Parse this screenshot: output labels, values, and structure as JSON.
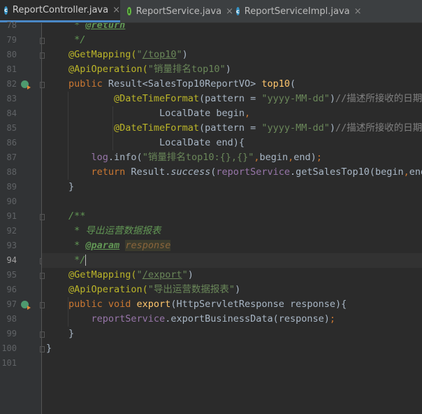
{
  "tabs": [
    {
      "label": "ReportController.java",
      "icon": "class-icon",
      "active": true
    },
    {
      "label": "ReportService.java",
      "icon": "interface-icon",
      "active": false
    },
    {
      "label": "ReportServiceImpl.java",
      "icon": "class-icon",
      "active": false
    }
  ],
  "tab_close_glyph": "×",
  "line_numbers": [
    "78",
    "79",
    "80",
    "81",
    "82",
    "83",
    "84",
    "85",
    "86",
    "87",
    "88",
    "89",
    "90",
    "91",
    "92",
    "93",
    "94",
    "95",
    "96",
    "97",
    "98",
    "99",
    "100",
    "101"
  ],
  "current_line": "94",
  "code_lines": [
    [
      {
        "t": " * ",
        "c": "dc"
      },
      {
        "t": "@return",
        "c": "dt"
      }
    ],
    [
      {
        "t": " */",
        "c": "dc"
      }
    ],
    [
      {
        "t": "@GetMapping(",
        "c": "an"
      },
      {
        "t": "\"",
        "c": "st"
      },
      {
        "t": "/top10",
        "c": "st ul"
      },
      {
        "t": "\"",
        "c": "st"
      },
      {
        "t": ")",
        "c": ""
      }
    ],
    [
      {
        "t": "@ApiOperation(",
        "c": "an"
      },
      {
        "t": "\"销量排名top10\"",
        "c": "st"
      },
      {
        "t": ")",
        "c": ""
      }
    ],
    [
      {
        "t": "public ",
        "c": "kw"
      },
      {
        "t": "Result<SalesTop10ReportVO> ",
        "c": ""
      },
      {
        "t": "top10",
        "c": "fn"
      },
      {
        "t": "(",
        "c": ""
      }
    ],
    [
      {
        "t": "        ",
        "c": ""
      },
      {
        "t": "@DateTimeFormat",
        "c": "an"
      },
      {
        "t": "(pattern = ",
        "c": ""
      },
      {
        "t": "\"yyyy-MM-dd\"",
        "c": "st"
      },
      {
        "t": ")",
        "c": ""
      },
      {
        "t": "//描述所接收的日期时",
        "c": "cm"
      }
    ],
    [
      {
        "t": "                ",
        "c": ""
      },
      {
        "t": "LocalDate begin",
        "c": ""
      },
      {
        "t": ",",
        "c": "kw"
      }
    ],
    [
      {
        "t": "        ",
        "c": ""
      },
      {
        "t": "@DateTimeFormat",
        "c": "an"
      },
      {
        "t": "(pattern = ",
        "c": ""
      },
      {
        "t": "\"yyyy-MM-dd\"",
        "c": "st"
      },
      {
        "t": ")",
        "c": ""
      },
      {
        "t": "//描述所接收的日期时",
        "c": "cm"
      }
    ],
    [
      {
        "t": "                ",
        "c": ""
      },
      {
        "t": "LocalDate end){",
        "c": ""
      }
    ],
    [
      {
        "t": "    ",
        "c": ""
      },
      {
        "t": "log",
        "c": "fd"
      },
      {
        "t": ".info(",
        "c": ""
      },
      {
        "t": "\"销量排名top10:{},{}\"",
        "c": "st"
      },
      {
        "t": ",",
        "c": "kw"
      },
      {
        "t": "begin",
        "c": ""
      },
      {
        "t": ",",
        "c": "kw"
      },
      {
        "t": "end)",
        "c": ""
      },
      {
        "t": ";",
        "c": "kw"
      }
    ],
    [
      {
        "t": "    ",
        "c": ""
      },
      {
        "t": "return ",
        "c": "kw"
      },
      {
        "t": "Result.",
        "c": ""
      },
      {
        "t": "success",
        "c": "it"
      },
      {
        "t": "(",
        "c": ""
      },
      {
        "t": "reportService",
        "c": "fd"
      },
      {
        "t": ".getSalesTop10(begin",
        "c": ""
      },
      {
        "t": ",",
        "c": "kw"
      },
      {
        "t": "end)",
        "c": ""
      }
    ],
    [
      {
        "t": "}",
        "c": ""
      }
    ],
    [],
    [
      {
        "t": "/**",
        "c": "dc"
      }
    ],
    [
      {
        "t": " * 导出运营数据报表",
        "c": "dc"
      }
    ],
    [
      {
        "t": " * ",
        "c": "dc"
      },
      {
        "t": "@param",
        "c": "dt"
      },
      {
        "t": " ",
        "c": "dc"
      },
      {
        "t": "response",
        "c": "dv"
      }
    ],
    [
      {
        "t": " */",
        "c": "dc"
      }
    ],
    [
      {
        "t": "@GetMapping(",
        "c": "an"
      },
      {
        "t": "\"",
        "c": "st"
      },
      {
        "t": "/export",
        "c": "st ul"
      },
      {
        "t": "\"",
        "c": "st"
      },
      {
        "t": ")",
        "c": ""
      }
    ],
    [
      {
        "t": "@ApiOperation(",
        "c": "an"
      },
      {
        "t": "\"导出运营数据报表\"",
        "c": "st"
      },
      {
        "t": ")",
        "c": ""
      }
    ],
    [
      {
        "t": "public void ",
        "c": "kw"
      },
      {
        "t": "export",
        "c": "fn"
      },
      {
        "t": "(HttpServletResponse response){",
        "c": ""
      }
    ],
    [
      {
        "t": "    ",
        "c": ""
      },
      {
        "t": "reportService",
        "c": "fd"
      },
      {
        "t": ".exportBusinessData(response)",
        "c": ""
      },
      {
        "t": ";",
        "c": "kw"
      }
    ],
    [
      {
        "t": "}",
        "c": ""
      }
    ],
    [
      {
        "t": "}",
        "c": ""
      }
    ],
    []
  ],
  "gutter_markers": {
    "run_icon_lines": [
      "82",
      "97"
    ]
  },
  "colors": {
    "background": "#2b2b2b",
    "keyword": "#cc7832",
    "annotation": "#bbb529",
    "string": "#6a8759",
    "comment": "#808080",
    "doc": "#629755",
    "method": "#ffc66d",
    "field": "#9876aa",
    "tab_active_underline": "#4a88c7"
  }
}
